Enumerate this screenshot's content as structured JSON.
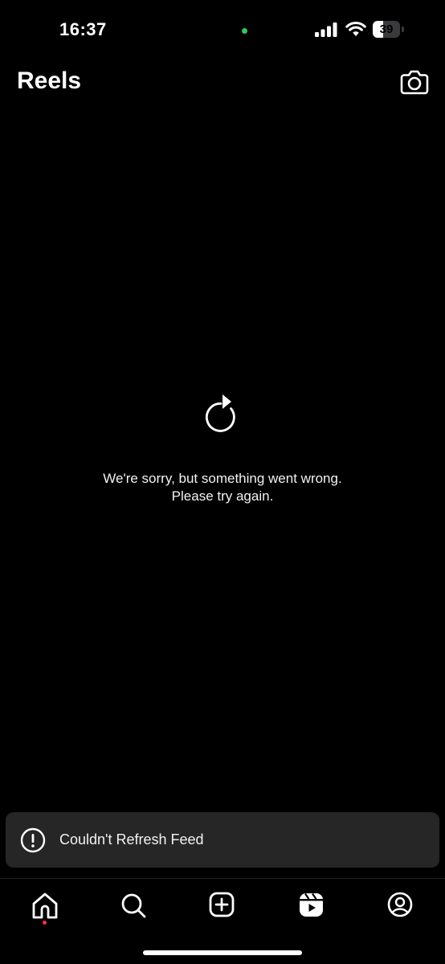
{
  "status_bar": {
    "time": "16:37",
    "battery_level": "39",
    "battery_percent": 39,
    "mic_indicator_color": "#34c759"
  },
  "header": {
    "title": "Reels",
    "camera_icon": "camera-icon"
  },
  "error": {
    "icon": "refresh-icon",
    "line1": "We're sorry, but something went wrong.",
    "line2": "Please try again."
  },
  "toast": {
    "icon": "alert-circle-icon",
    "message": "Couldn't Refresh Feed",
    "background": "#262626"
  },
  "bottom_nav": {
    "items": [
      {
        "name": "home",
        "icon": "home-icon",
        "active": true,
        "has_notification_dot": true
      },
      {
        "name": "search",
        "icon": "search-icon",
        "active": false
      },
      {
        "name": "create",
        "icon": "add-square-icon",
        "active": false
      },
      {
        "name": "reels",
        "icon": "reels-icon",
        "active": true
      },
      {
        "name": "profile",
        "icon": "profile-icon",
        "active": false
      }
    ],
    "notification_dot_color": "#ff3040"
  }
}
